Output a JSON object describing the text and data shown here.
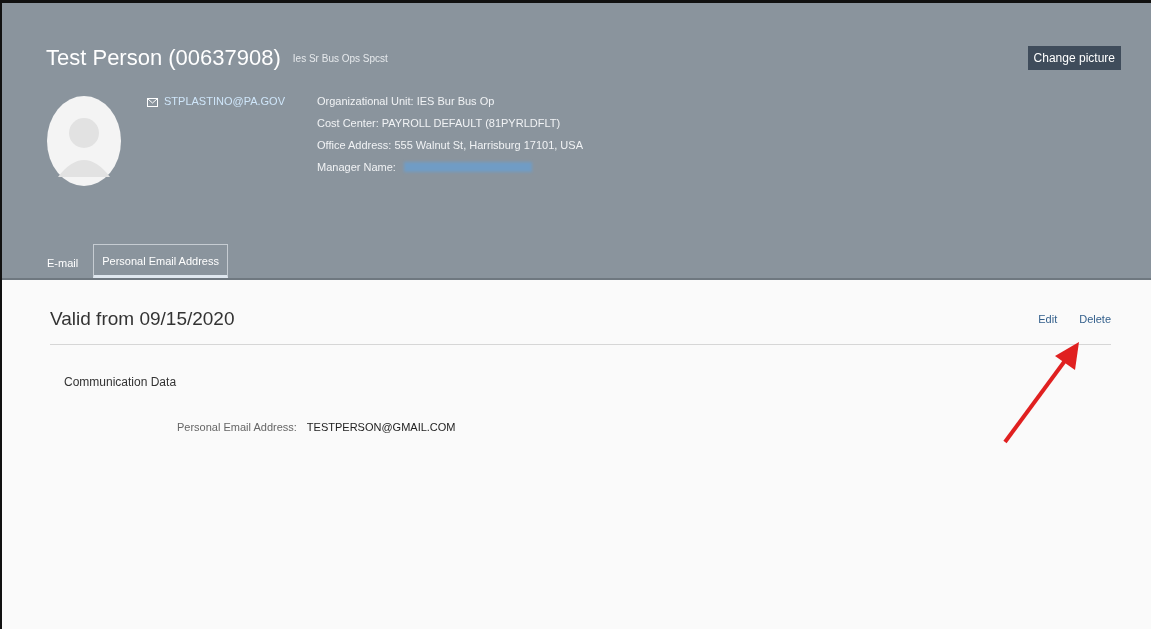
{
  "header": {
    "name": "Test Person (00637908)",
    "position": "Ies Sr Bus Ops Spcst",
    "change_picture_button": "Change picture",
    "email": "STPLASTINO@PA.GOV",
    "details": [
      {
        "label": "Organizational Unit:",
        "value": "IES Bur Bus Op"
      },
      {
        "label": "Cost Center:",
        "value": "PAYROLL DEFAULT (81PYRLDFLT)"
      },
      {
        "label": "Office Address:",
        "value": "555 Walnut St, Harrisburg 17101, USA"
      },
      {
        "label": "Manager Name:",
        "kind": "redacted-link"
      }
    ],
    "tabs": [
      {
        "label": "E-mail",
        "selected": false
      },
      {
        "label": "Personal Email Address",
        "selected": true
      }
    ]
  },
  "record": {
    "title": "Valid from 09/15/2020",
    "actions": [
      "Edit",
      "Delete"
    ],
    "section": "Communication Data",
    "fields": [
      {
        "label": "Personal Email Address:",
        "value": "TESTPERSON@GMAIL.COM"
      }
    ]
  }
}
